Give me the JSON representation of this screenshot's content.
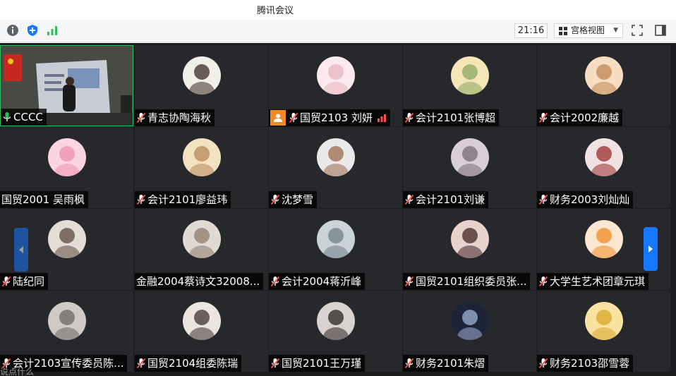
{
  "window": {
    "title": "腾讯会议"
  },
  "toolbar": {
    "time": "21:16",
    "view_label": "宫格视图",
    "view_caret": "▼"
  },
  "colors": {
    "accent": "#1677ff",
    "active_border": "#2fbf5b",
    "host_badge": "#f08a24",
    "muted_mic": "#ff4d4f"
  },
  "participants": [
    {
      "name": "CCCC",
      "mic": "active",
      "shared_video": true
    },
    {
      "name": "青志协陶海秋",
      "mic": "muted"
    },
    {
      "name": "国贸2103 刘妍",
      "mic": "muted",
      "host": true,
      "signal": true
    },
    {
      "name": "会计2101张博超",
      "mic": "muted"
    },
    {
      "name": "会计2002廉越",
      "mic": "muted"
    },
    {
      "name": "国贸2001 吴雨枫",
      "mic": "none"
    },
    {
      "name": "会计2101廖益玮",
      "mic": "muted"
    },
    {
      "name": "沈梦雪",
      "mic": "muted"
    },
    {
      "name": "会计2101刘谦",
      "mic": "muted"
    },
    {
      "name": "财务2003刘灿灿",
      "mic": "muted"
    },
    {
      "name": "陆纪同",
      "mic": "muted"
    },
    {
      "name": "金融2004蔡诗文32008...",
      "mic": "none"
    },
    {
      "name": "会计2004蒋沂峰",
      "mic": "muted"
    },
    {
      "name": "国贸2101组织委员张...",
      "mic": "muted"
    },
    {
      "name": "大学生艺术团章元琪",
      "mic": "muted"
    },
    {
      "name": "会计2103宣传委员陈...",
      "mic": "muted"
    },
    {
      "name": "国贸2104组委陈瑞",
      "mic": "muted"
    },
    {
      "name": "国贸2101王万瑾",
      "mic": "muted"
    },
    {
      "name": "财务2101朱熠",
      "mic": "muted"
    },
    {
      "name": "财务2103邵雪蓉",
      "mic": "muted"
    }
  ],
  "chat": {
    "hint": "说点什么"
  }
}
